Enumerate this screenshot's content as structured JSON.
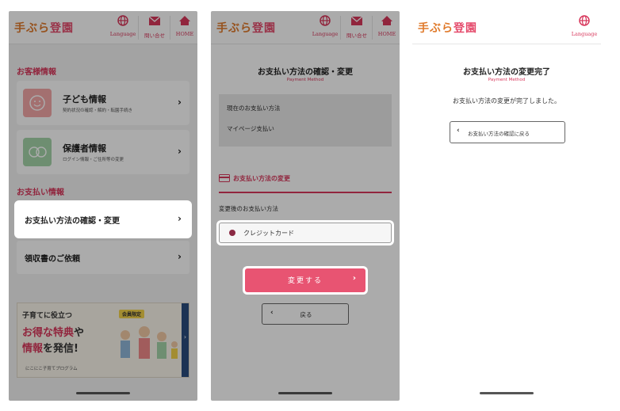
{
  "common": {
    "logo": {
      "part1": "手ぶら",
      "part2": "登園"
    },
    "nav_language": "Language",
    "nav_contact": "問い合せ",
    "nav_home": "HOME"
  },
  "screen1": {
    "customer_section": "お客様情報",
    "child_card": {
      "title": "子ども情報",
      "subtitle": "契約状況の確認・解約・転園手続き"
    },
    "guardian_card": {
      "title": "保護者情報",
      "subtitle": "ログイン情報・ご住所等の変更"
    },
    "payment_section": "お支払い情報",
    "payment_item": "お支払い方法の確認・変更",
    "receipt_item": "領収書のご依頼",
    "banner": {
      "line1": "子育てに役立つ",
      "line2a": "お得な",
      "line2b": "特典",
      "line2c": "や",
      "line3a": "情報",
      "line3b": "を発信!",
      "badge": "会員限定",
      "footer": "にこにこ子育てプログラム"
    }
  },
  "screen2": {
    "title": "お支払い方法の確認・変更",
    "subtitle": "Payment Method",
    "current_label": "現在のお支払い方法",
    "current_value": "マイページ支払い",
    "change_heading": "お支払い方法の変更",
    "after_label": "変更後のお支払い方法",
    "option_credit": "クレジットカード",
    "submit_label": "変更する",
    "back_label": "戻る"
  },
  "screen3": {
    "title": "お支払い方法の変更完了",
    "subtitle": "Payment Method",
    "message": "お支払い方法の変更が完了しました。",
    "back_label": "お支払い方法の確認に戻る"
  },
  "colors": {
    "accent": "#d8385c",
    "button": "#e85472",
    "logo": "#e07a2b"
  }
}
